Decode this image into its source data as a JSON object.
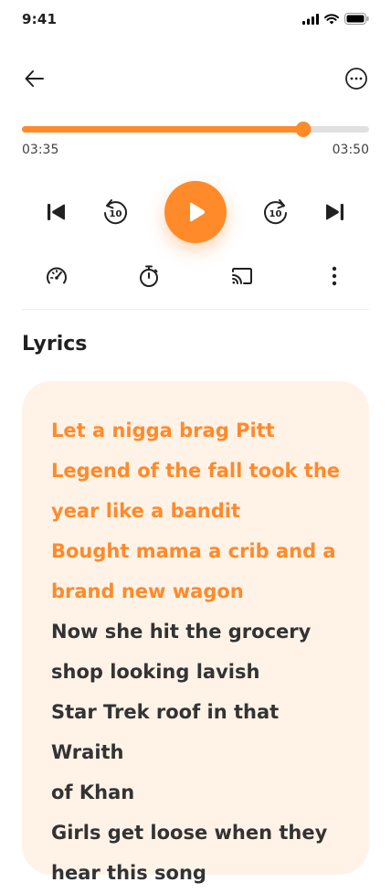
{
  "status_bar": {
    "time": "9:41"
  },
  "player": {
    "progress": 0.81,
    "current_time": "03:35",
    "total_time": "03:50",
    "skip_back_seconds": "10",
    "skip_forward_seconds": "10"
  },
  "lyrics": {
    "title": "Lyrics",
    "lines": [
      {
        "text": "Let a nigga brag Pitt",
        "active": true
      },
      {
        "text": "Legend of the fall took the",
        "active": true
      },
      {
        "text": "year like a bandit",
        "active": true
      },
      {
        "text": "Bought mama a crib and a",
        "active": true
      },
      {
        "text": "brand new wagon",
        "active": true
      },
      {
        "text": "Now she hit the grocery",
        "active": false
      },
      {
        "text": "shop looking lavish",
        "active": false
      },
      {
        "text": "Star Trek roof in that Wraith",
        "active": false
      },
      {
        "text": "of Khan",
        "active": false
      },
      {
        "text": "Girls get loose when they",
        "active": false
      },
      {
        "text": "hear this song",
        "active": false
      }
    ]
  },
  "colors": {
    "accent": "#ff8a2a",
    "lyrics_card_bg": "#fff3e8",
    "text_primary": "#212121"
  },
  "icons": {
    "back": "arrow-left-icon",
    "more": "more-circle-icon",
    "previous": "skip-previous-icon",
    "rewind": "rewind-10-icon",
    "play": "play-icon",
    "forward": "forward-10-icon",
    "next": "skip-next-icon",
    "speed": "speedometer-icon",
    "timer": "timer-icon",
    "cast": "cast-icon",
    "options": "more-vertical-icon"
  }
}
